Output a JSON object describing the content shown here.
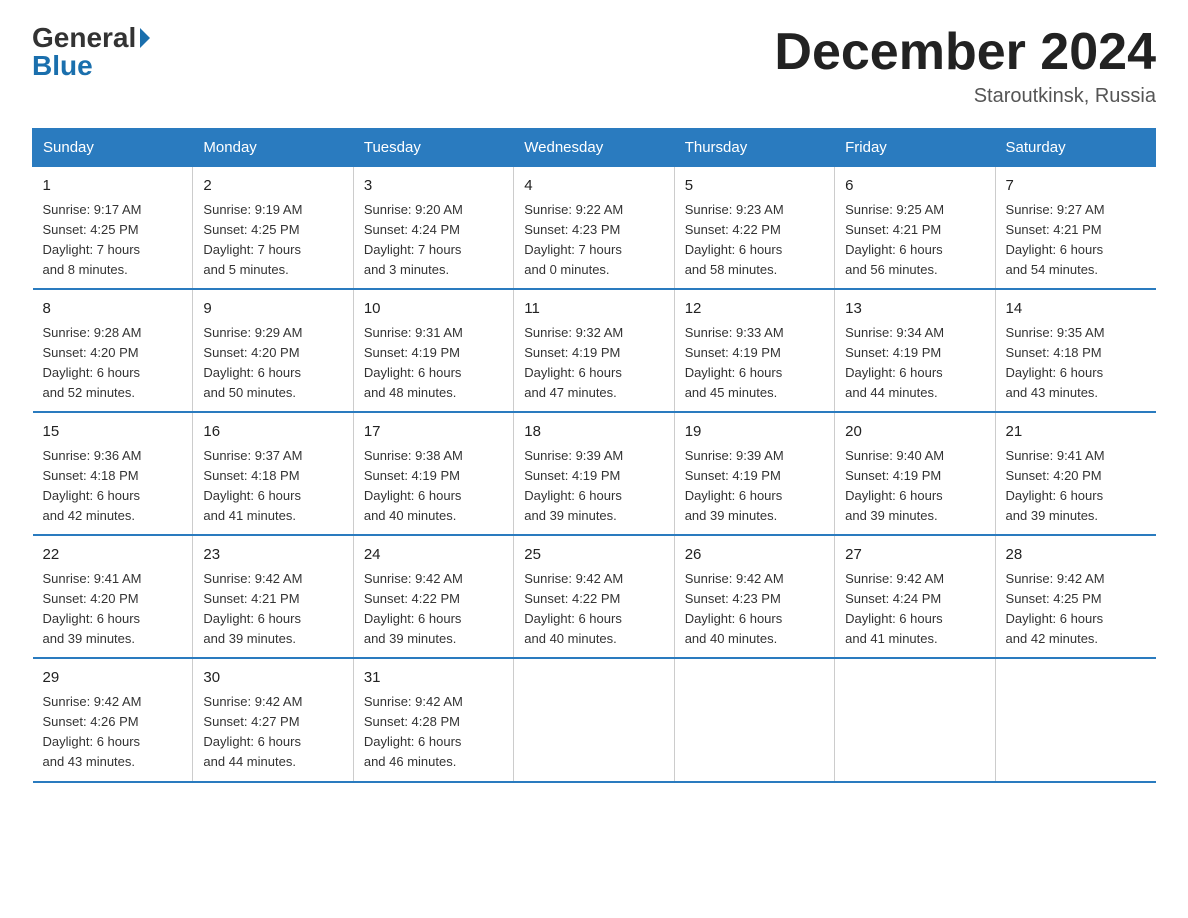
{
  "logo": {
    "general": "General",
    "blue": "Blue"
  },
  "title": "December 2024",
  "location": "Staroutkinsk, Russia",
  "weekdays": [
    "Sunday",
    "Monday",
    "Tuesday",
    "Wednesday",
    "Thursday",
    "Friday",
    "Saturday"
  ],
  "weeks": [
    [
      {
        "day": "1",
        "info": "Sunrise: 9:17 AM\nSunset: 4:25 PM\nDaylight: 7 hours\nand 8 minutes."
      },
      {
        "day": "2",
        "info": "Sunrise: 9:19 AM\nSunset: 4:25 PM\nDaylight: 7 hours\nand 5 minutes."
      },
      {
        "day": "3",
        "info": "Sunrise: 9:20 AM\nSunset: 4:24 PM\nDaylight: 7 hours\nand 3 minutes."
      },
      {
        "day": "4",
        "info": "Sunrise: 9:22 AM\nSunset: 4:23 PM\nDaylight: 7 hours\nand 0 minutes."
      },
      {
        "day": "5",
        "info": "Sunrise: 9:23 AM\nSunset: 4:22 PM\nDaylight: 6 hours\nand 58 minutes."
      },
      {
        "day": "6",
        "info": "Sunrise: 9:25 AM\nSunset: 4:21 PM\nDaylight: 6 hours\nand 56 minutes."
      },
      {
        "day": "7",
        "info": "Sunrise: 9:27 AM\nSunset: 4:21 PM\nDaylight: 6 hours\nand 54 minutes."
      }
    ],
    [
      {
        "day": "8",
        "info": "Sunrise: 9:28 AM\nSunset: 4:20 PM\nDaylight: 6 hours\nand 52 minutes."
      },
      {
        "day": "9",
        "info": "Sunrise: 9:29 AM\nSunset: 4:20 PM\nDaylight: 6 hours\nand 50 minutes."
      },
      {
        "day": "10",
        "info": "Sunrise: 9:31 AM\nSunset: 4:19 PM\nDaylight: 6 hours\nand 48 minutes."
      },
      {
        "day": "11",
        "info": "Sunrise: 9:32 AM\nSunset: 4:19 PM\nDaylight: 6 hours\nand 47 minutes."
      },
      {
        "day": "12",
        "info": "Sunrise: 9:33 AM\nSunset: 4:19 PM\nDaylight: 6 hours\nand 45 minutes."
      },
      {
        "day": "13",
        "info": "Sunrise: 9:34 AM\nSunset: 4:19 PM\nDaylight: 6 hours\nand 44 minutes."
      },
      {
        "day": "14",
        "info": "Sunrise: 9:35 AM\nSunset: 4:18 PM\nDaylight: 6 hours\nand 43 minutes."
      }
    ],
    [
      {
        "day": "15",
        "info": "Sunrise: 9:36 AM\nSunset: 4:18 PM\nDaylight: 6 hours\nand 42 minutes."
      },
      {
        "day": "16",
        "info": "Sunrise: 9:37 AM\nSunset: 4:18 PM\nDaylight: 6 hours\nand 41 minutes."
      },
      {
        "day": "17",
        "info": "Sunrise: 9:38 AM\nSunset: 4:19 PM\nDaylight: 6 hours\nand 40 minutes."
      },
      {
        "day": "18",
        "info": "Sunrise: 9:39 AM\nSunset: 4:19 PM\nDaylight: 6 hours\nand 39 minutes."
      },
      {
        "day": "19",
        "info": "Sunrise: 9:39 AM\nSunset: 4:19 PM\nDaylight: 6 hours\nand 39 minutes."
      },
      {
        "day": "20",
        "info": "Sunrise: 9:40 AM\nSunset: 4:19 PM\nDaylight: 6 hours\nand 39 minutes."
      },
      {
        "day": "21",
        "info": "Sunrise: 9:41 AM\nSunset: 4:20 PM\nDaylight: 6 hours\nand 39 minutes."
      }
    ],
    [
      {
        "day": "22",
        "info": "Sunrise: 9:41 AM\nSunset: 4:20 PM\nDaylight: 6 hours\nand 39 minutes."
      },
      {
        "day": "23",
        "info": "Sunrise: 9:42 AM\nSunset: 4:21 PM\nDaylight: 6 hours\nand 39 minutes."
      },
      {
        "day": "24",
        "info": "Sunrise: 9:42 AM\nSunset: 4:22 PM\nDaylight: 6 hours\nand 39 minutes."
      },
      {
        "day": "25",
        "info": "Sunrise: 9:42 AM\nSunset: 4:22 PM\nDaylight: 6 hours\nand 40 minutes."
      },
      {
        "day": "26",
        "info": "Sunrise: 9:42 AM\nSunset: 4:23 PM\nDaylight: 6 hours\nand 40 minutes."
      },
      {
        "day": "27",
        "info": "Sunrise: 9:42 AM\nSunset: 4:24 PM\nDaylight: 6 hours\nand 41 minutes."
      },
      {
        "day": "28",
        "info": "Sunrise: 9:42 AM\nSunset: 4:25 PM\nDaylight: 6 hours\nand 42 minutes."
      }
    ],
    [
      {
        "day": "29",
        "info": "Sunrise: 9:42 AM\nSunset: 4:26 PM\nDaylight: 6 hours\nand 43 minutes."
      },
      {
        "day": "30",
        "info": "Sunrise: 9:42 AM\nSunset: 4:27 PM\nDaylight: 6 hours\nand 44 minutes."
      },
      {
        "day": "31",
        "info": "Sunrise: 9:42 AM\nSunset: 4:28 PM\nDaylight: 6 hours\nand 46 minutes."
      },
      {
        "day": "",
        "info": ""
      },
      {
        "day": "",
        "info": ""
      },
      {
        "day": "",
        "info": ""
      },
      {
        "day": "",
        "info": ""
      }
    ]
  ]
}
